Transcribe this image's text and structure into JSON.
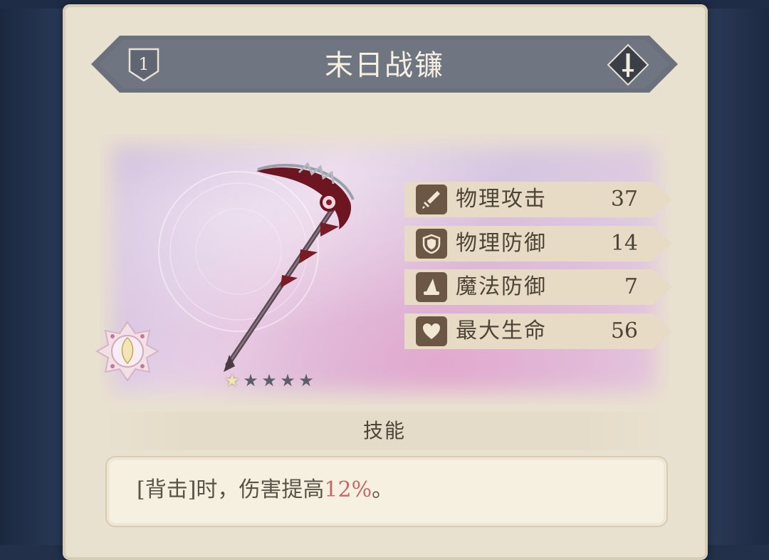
{
  "item": {
    "level": "1",
    "name": "末日战镰",
    "type_icon": "sword-icon",
    "rarity": {
      "filled": 1,
      "total": 5
    }
  },
  "stats": [
    {
      "icon": "sword-icon",
      "label": "物理攻击",
      "value": "37"
    },
    {
      "icon": "shield-icon",
      "label": "物理防御",
      "value": "14"
    },
    {
      "icon": "wizard-hat-icon",
      "label": "魔法防御",
      "value": "7"
    },
    {
      "icon": "heart-icon",
      "label": "最大生命",
      "value": "56"
    }
  ],
  "skill": {
    "title": "技能",
    "text_prefix": "[背击]时，伤害提高",
    "text_highlight": "12%",
    "text_suffix": "。"
  },
  "colors": {
    "banner": "#6a707c",
    "panel": "#e9e1cf",
    "stat_icon_bg": "#6b5744",
    "highlight": "#c46a6a",
    "star_filled": "#f4e6a8",
    "star_empty": "#5c5e6b"
  }
}
